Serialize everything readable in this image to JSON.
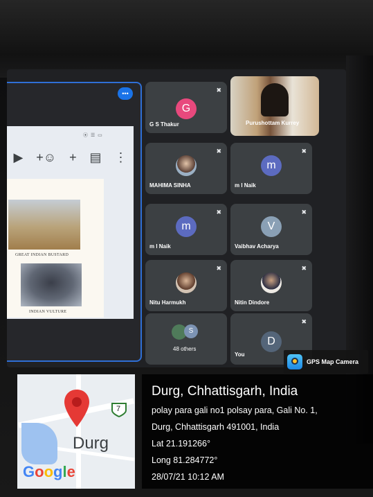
{
  "meeting": {
    "presentation_badge": "•••",
    "slide_status": "⦿ ☰ ▭",
    "slide_captions": [
      "GREAT INDIAN BUSTARD",
      "INDIAN VULTURE"
    ],
    "toolbar_icons": [
      "▶",
      "+☺",
      "+",
      "▤",
      "⋮"
    ],
    "participants": [
      {
        "name": "G S Thakur",
        "avatar": "G",
        "color": "#e8497d",
        "muted": true
      },
      {
        "name": "Purushottam Kurrey",
        "avatar": "",
        "color": "",
        "muted": false
      },
      {
        "name": "MAHIMA SINHA",
        "avatar": "",
        "color": "#7b8fa6",
        "muted": true
      },
      {
        "name": "m l Naik",
        "avatar": "m",
        "color": "#5c6bc0",
        "muted": true
      },
      {
        "name": "m l Naik",
        "avatar": "m",
        "color": "#5c6bc0",
        "muted": true
      },
      {
        "name": "Vaibhav Acharya",
        "avatar": "V",
        "color": "#8aa0b5",
        "muted": true
      },
      {
        "name": "Nitu Harmukh",
        "avatar": "",
        "color": "#c7a58a",
        "muted": true
      },
      {
        "name": "Nitin Dindore",
        "avatar": "",
        "color": "#e6e0d8",
        "muted": true
      },
      {
        "name": "48 others",
        "avatar": "S",
        "color": "#6f8d7a",
        "muted": false
      },
      {
        "name": "You",
        "avatar": "D",
        "color": "#546579",
        "muted": true
      }
    ],
    "mic_off_icon": "✖"
  },
  "gps": {
    "app_name": "GPS Map Camera",
    "city_title": "Durg, Chhattisgarh, India",
    "address_line1": "polay para gali no1 polsay para, Gali No. 1,",
    "address_line2": "Durg, Chhattisgarh 491001, India",
    "lat": "Lat 21.191266°",
    "long": "Long 81.284772°",
    "datetime": "28/07/21 10:12 AM",
    "map_label": "Durg",
    "map_brand": "Google",
    "road_shield": "7",
    "brand_colors": [
      "#4285F4",
      "#EA4335",
      "#FBBC05",
      "#4285F4",
      "#34A853",
      "#EA4335"
    ]
  }
}
